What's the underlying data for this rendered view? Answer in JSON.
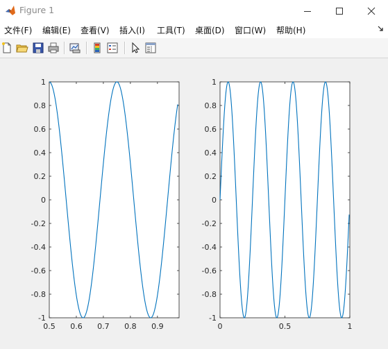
{
  "window": {
    "title": "Figure 1"
  },
  "menu": {
    "items": [
      "文件(F)",
      "编辑(E)",
      "查看(V)",
      "插入(I)",
      "工具(T)",
      "桌面(D)",
      "窗口(W)",
      "帮助(H)"
    ]
  },
  "toolbar": {
    "buttons": [
      "new-figure-icon",
      "open-file-icon",
      "save-icon",
      "print-icon",
      "link-plot-icon",
      "insert-colorbar-icon",
      "insert-legend-icon",
      "edit-plot-icon",
      "property-inspector-icon"
    ]
  },
  "colors": {
    "line": "#0072bd",
    "axes_bg": "#ffffff",
    "figure_bg": "#f0f0f0"
  },
  "chart_data": [
    {
      "type": "line",
      "xlim": [
        0.5,
        0.98
      ],
      "ylim": [
        -1,
        1
      ],
      "xticks": [
        0.5,
        0.6,
        0.7,
        0.8,
        0.9
      ],
      "xtick_labels": [
        "0.5",
        "0.6",
        "0.7",
        "0.8",
        "0.9"
      ],
      "yticks": [
        1,
        0.8,
        0.6,
        0.4,
        0.2,
        0,
        -0.2,
        -0.4,
        -0.6,
        -0.8,
        -1
      ],
      "ytick_labels": [
        "1",
        "0.8",
        "0.6",
        "0.4",
        "0.2",
        "0",
        "-0.2",
        "-0.4",
        "-0.6",
        "-0.8",
        "-1"
      ],
      "series": [
        {
          "x_start": 0.5,
          "x_end": 0.975,
          "function": "cos",
          "frequency": 4,
          "phase": 0
        }
      ]
    },
    {
      "type": "line",
      "xlim": [
        0,
        1
      ],
      "ylim": [
        -1,
        1
      ],
      "xticks": [
        0,
        0.5,
        1
      ],
      "xtick_labels": [
        "0",
        "0.5",
        "1"
      ],
      "yticks": [
        1,
        0.8,
        0.6,
        0.4,
        0.2,
        0,
        -0.2,
        -0.4,
        -0.6,
        -0.8,
        -1
      ],
      "ytick_labels": [
        "1",
        "0.8",
        "0.6",
        "0.4",
        "0.2",
        "0",
        "-0.2",
        "-0.4",
        "-0.6",
        "-0.8",
        "-1"
      ],
      "series": [
        {
          "x_start": 0,
          "x_end": 0.995,
          "function": "sin",
          "frequency": 4,
          "phase": 0
        }
      ]
    }
  ]
}
